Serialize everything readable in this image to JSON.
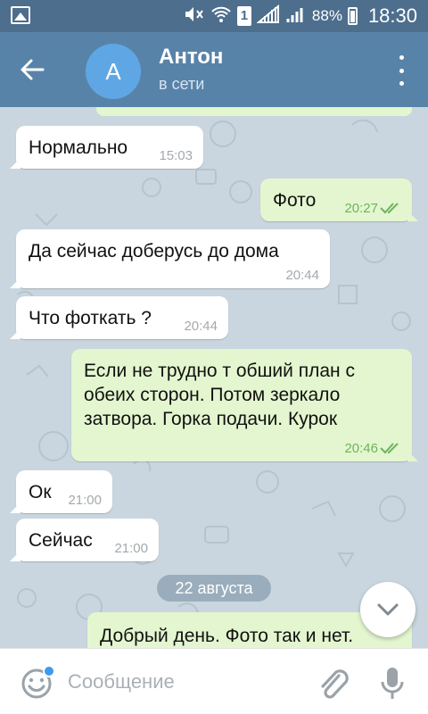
{
  "status_bar": {
    "time": "18:30",
    "battery_percent": "88%",
    "sim_label": "1",
    "icons": [
      "gallery-icon",
      "mute-icon",
      "wifi-icon",
      "sim-icon",
      "signal-icon",
      "battery-icon"
    ]
  },
  "header": {
    "avatar_letter": "А",
    "name": "Антон",
    "status": "в сети",
    "avatar_color": "#5fa7e4",
    "bar_color": "#5883a9"
  },
  "messages": [
    {
      "dir": "in",
      "text": "Нормально",
      "time": "15:03"
    },
    {
      "dir": "out",
      "text": "Фото",
      "time": "20:27",
      "read": true
    },
    {
      "dir": "in",
      "text": "Да сейчас доберусь до дома",
      "time": "20:44"
    },
    {
      "dir": "in",
      "text": "Что фоткать ?",
      "time": "20:44"
    },
    {
      "dir": "out",
      "lines": [
        "Если не трудно т обший план с",
        "обеих сторон. Потом зеркало",
        "затвора. Горка подачи. Курок"
      ],
      "time": "20:46",
      "read": true
    },
    {
      "dir": "in",
      "text": "Ок",
      "time": "21:00"
    },
    {
      "dir": "in",
      "text": "Сейчас",
      "time": "21:00"
    },
    {
      "dir": "out",
      "text": "Добрый день. Фото так и нет."
    }
  ],
  "date_separator": "22 августа",
  "input": {
    "placeholder": "Сообщение",
    "value": ""
  },
  "colors": {
    "incoming_bubble": "#ffffff",
    "outgoing_bubble": "#e3f6cf",
    "read_check": "#6fb35e",
    "chat_background": "#c9d6df"
  }
}
